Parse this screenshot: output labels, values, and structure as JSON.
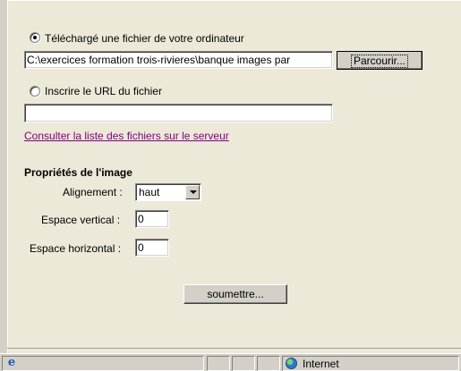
{
  "upload": {
    "local_option_label": "Téléchargé une fichier de votre ordinateur",
    "local_option_checked": true,
    "file_path_value": "C:\\exercices formation trois-rivieres\\banque images par",
    "browse_button_label": "Parcourir...",
    "url_option_label": "Inscrire le URL du fichier",
    "url_option_checked": false,
    "url_value": "",
    "server_list_link": "Consulter la liste des fichiers sur le serveur"
  },
  "properties": {
    "title": "Propriétés de l'image",
    "alignment_label": "Alignement :",
    "alignment_value": "haut",
    "vertical_space_label": "Espace vertical :",
    "vertical_space_value": "0",
    "horizontal_space_label": "Espace horizontal :",
    "horizontal_space_value": "0"
  },
  "submit_label": "soumettre...",
  "statusbar": {
    "zone_text": "Internet",
    "page_icon": "ie-page-icon",
    "zone_icon": "globe-icon"
  }
}
